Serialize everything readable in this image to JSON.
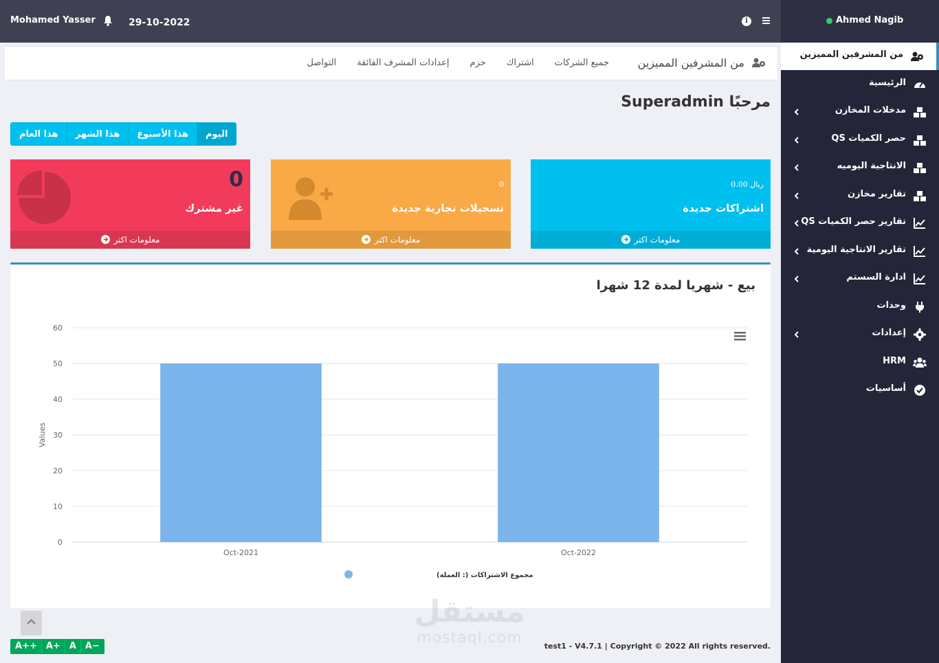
{
  "topbar": {
    "user_name": "Mohamed Yasser",
    "date": "29-10-2022"
  },
  "sidebar": {
    "user_name": "Ahmed Nagib",
    "items": [
      {
        "label": "من المشرفين المميزين",
        "icon": "users-cog-icon",
        "active": true,
        "has_children": false
      },
      {
        "label": "الرئيسية",
        "icon": "dashboard-gauge-icon",
        "active": false,
        "has_children": false
      },
      {
        "label": "مدخلات المخازن",
        "icon": "boxes-icon",
        "active": false,
        "has_children": true
      },
      {
        "label": "حصر الكميات QS",
        "icon": "boxes-icon",
        "active": false,
        "has_children": true
      },
      {
        "label": "الانتاجية اليوميه",
        "icon": "boxes-icon",
        "active": false,
        "has_children": true
      },
      {
        "label": "تقارير مخازن",
        "icon": "boxes-icon",
        "active": false,
        "has_children": true
      },
      {
        "label": "تقارير حصر الكميات QS",
        "icon": "line-chart-icon",
        "active": false,
        "has_children": true
      },
      {
        "label": "تقارير الانتاجية اليومية",
        "icon": "line-chart-icon",
        "active": false,
        "has_children": true
      },
      {
        "label": "ادارة السستم",
        "icon": "line-chart-icon",
        "active": false,
        "has_children": true
      },
      {
        "label": "وحدات",
        "icon": "plug-icon",
        "active": false,
        "has_children": false
      },
      {
        "label": "إعدادات",
        "icon": "gear-icon",
        "active": false,
        "has_children": true
      },
      {
        "label": "HRM",
        "icon": "users-icon",
        "active": false,
        "has_children": false
      },
      {
        "label": "أساسيات",
        "icon": "check-circle-icon",
        "active": false,
        "has_children": false
      }
    ]
  },
  "nav": {
    "brand": "من المشرفين المميزين",
    "links": [
      "جميع الشركات",
      "اشتراك",
      "حزم",
      "إعدادات المشرف الفائقة",
      "التواصل"
    ]
  },
  "welcome": "مرحبًا Superadmin",
  "periods": [
    "اليوم",
    "هذا الأسبوع",
    "هذا الشهر",
    "هذا العام"
  ],
  "stats": [
    {
      "value": "ريال 0.00",
      "title": "اشتراكات جديدة",
      "footer": "معلومات اكتر",
      "color": "#00c0ef",
      "footer_color": "#00add7"
    },
    {
      "value": "0",
      "title": "تسجيلات تجارية جديدة",
      "footer": "معلومات اكتر",
      "color": "#f9a945",
      "footer_color": "#e2993e"
    },
    {
      "value": "0",
      "title": "غير مشترك",
      "footer": "معلومات اكتر",
      "color": "#f23b5b",
      "footer_color": "#d93652"
    }
  ],
  "chart": {
    "title": "بيع - شهريا لمدة 12 شهرا"
  },
  "chart_data": {
    "type": "bar",
    "categories": [
      "Oct-2021",
      "Oct-2022"
    ],
    "series": [
      {
        "name": "مجموع الاشتراكات (: العملة)",
        "values": [
          50,
          50
        ],
        "color": "#7cb5ec"
      }
    ],
    "ylabel": "Values",
    "ylim": [
      0,
      60
    ],
    "yticks": [
      0,
      10,
      20,
      30,
      40,
      50,
      60
    ],
    "grid": true,
    "legend": "bottom-center"
  },
  "footer": {
    "font_buttons": [
      "A++",
      "A+",
      "A",
      "A−"
    ],
    "copyright": "test1 - V4.7.1 | Copyright © 2022 All rights reserved.",
    "watermark_ar": "مستقل",
    "watermark_lat": "mostaql.com"
  }
}
